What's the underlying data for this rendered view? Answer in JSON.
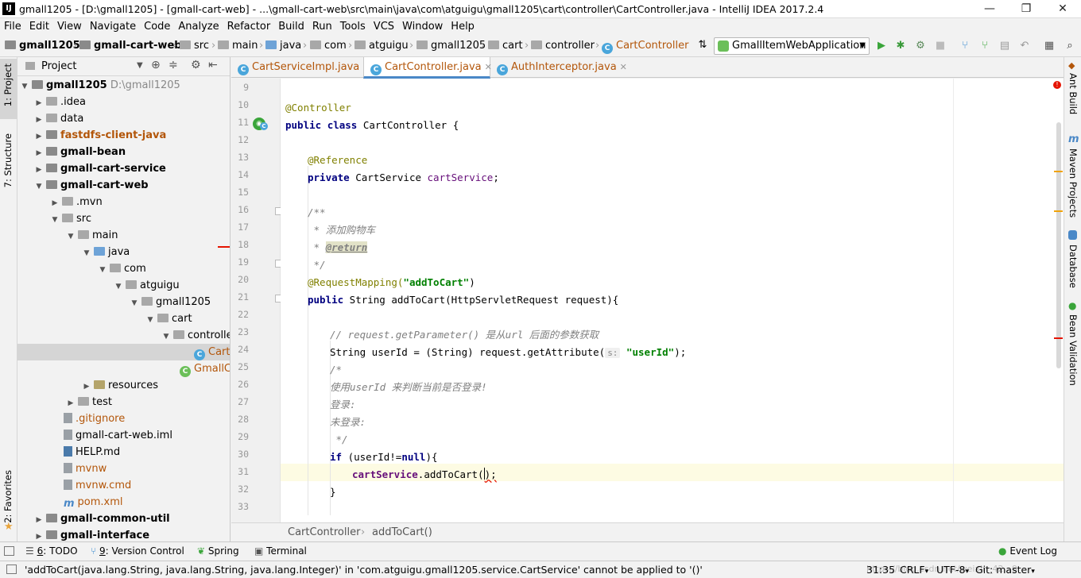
{
  "window": {
    "title": "gmall1205 - [D:\\gmall1205] - [gmall-cart-web] - ...\\gmall-cart-web\\src\\main\\java\\com\\atguigu\\gmall1205\\cart\\controller\\CartController.java - IntelliJ IDEA 2017.2.4",
    "minimize": "—",
    "maximize": "❐",
    "close": "✕"
  },
  "menu": [
    "File",
    "Edit",
    "View",
    "Navigate",
    "Code",
    "Analyze",
    "Refactor",
    "Build",
    "Run",
    "Tools",
    "VCS",
    "Window",
    "Help"
  ],
  "navbar": {
    "crumbs": [
      "gmall1205",
      "gmall-cart-web",
      "src",
      "main",
      "java",
      "com",
      "atguigu",
      "gmall1205",
      "cart",
      "controller",
      "CartController"
    ],
    "run_config": "GmallItemWebApplication"
  },
  "left_stripe": {
    "project": "1: Project",
    "structure": "7: Structure",
    "favorites": "2: Favorites"
  },
  "right_stripe": {
    "ant": "Ant Build",
    "maven": "Maven Projects",
    "database": "Database",
    "bean": "Bean Validation"
  },
  "project_panel": {
    "title": "Project",
    "tree": [
      {
        "label": "gmall1205",
        "extra": "D:\\gmall1205",
        "arrow": "▼"
      },
      {
        "label": ".idea",
        "arrow": "▶"
      },
      {
        "label": "data",
        "arrow": "▶"
      },
      {
        "label": "fastdfs-client-java",
        "arrow": "▶"
      },
      {
        "label": "gmall-bean",
        "arrow": "▶"
      },
      {
        "label": "gmall-cart-service",
        "arrow": "▶"
      },
      {
        "label": "gmall-cart-web",
        "arrow": "▼"
      },
      {
        "label": ".mvn",
        "arrow": "▶"
      },
      {
        "label": "src",
        "arrow": "▼"
      },
      {
        "label": "main",
        "arrow": "▼"
      },
      {
        "label": "java",
        "arrow": "▼"
      },
      {
        "label": "com",
        "arrow": "▼"
      },
      {
        "label": "atguigu",
        "arrow": "▼"
      },
      {
        "label": "gmall1205",
        "arrow": "▼"
      },
      {
        "label": "cart",
        "arrow": "▼"
      },
      {
        "label": "controller",
        "arrow": "▼"
      },
      {
        "label": "Cart"
      },
      {
        "label": "GmallCa"
      },
      {
        "label": "resources",
        "arrow": "▶"
      },
      {
        "label": "test",
        "arrow": "▶"
      },
      {
        "label": ".gitignore"
      },
      {
        "label": "gmall-cart-web.iml"
      },
      {
        "label": "HELP.md"
      },
      {
        "label": "mvnw"
      },
      {
        "label": "mvnw.cmd"
      },
      {
        "label": "pom.xml"
      },
      {
        "label": "gmall-common-util",
        "arrow": "▶"
      },
      {
        "label": "gmall-interface",
        "arrow": "▶"
      }
    ]
  },
  "tabs": [
    "CartServiceImpl.java",
    "CartController.java",
    "AuthInterceptor.java"
  ],
  "editor": {
    "line_numbers": [
      "9",
      "10",
      "11",
      "12",
      "13",
      "14",
      "15",
      "16",
      "17",
      "18",
      "19",
      "20",
      "21",
      "22",
      "23",
      "24",
      "25",
      "26",
      "27",
      "28",
      "29",
      "30",
      "31",
      "32",
      "33"
    ],
    "l10_ann": "@Controller",
    "l11_kw1": "public",
    "l11_kw2": "class",
    "l11_rest": " CartController {",
    "l13_ann": "@Reference",
    "l14_kw": "private",
    "l14_type": " CartService ",
    "l14_field": "cartService",
    "l14_end": ";",
    "l16": "/**",
    "l17": " * 添加购物车",
    "l18_star": " * ",
    "l18_tag": "@return",
    "l19": " */",
    "l20_ann": "@RequestMapping(",
    "l20_str": "\"addToCart\"",
    "l20_end": ")",
    "l21_kw": "public",
    "l21_rest": " String addToCart(HttpServletRequest request){",
    "l23": "// request.getParameter() 是从url 后面的参数获取",
    "l24_pre": "String userId = (String) request.getAttribute(",
    "l24_hint": "s:",
    "l24_str": "\"userId\"",
    "l24_end": ");",
    "l25": "/*",
    "l26": "使用userId 来判断当前是否登录!",
    "l27": "登录:",
    "l28": "未登录:",
    "l29": " */",
    "l30_kw": "if",
    "l30_mid": " (userId!=",
    "l30_kw2": "null",
    "l30_end": "){",
    "l31_field": "cartService",
    "l31_rest": ".addToCart(",
    "l31_end": ");",
    "l32": "}"
  },
  "editor_breadcrumb": [
    "CartController",
    "addToCart()"
  ],
  "bottom_tools": [
    {
      "num": "6",
      "label": ": TODO"
    },
    {
      "num": "9",
      "label": ": Version Control"
    },
    {
      "num": "",
      "label": "Spring"
    },
    {
      "num": "",
      "label": "Terminal"
    }
  ],
  "event_log": "Event Log",
  "status": {
    "message": "'addToCart(java.lang.String, java.lang.String, java.lang.Integer)' in 'com.atguigu.gmall1205.service.CartService' cannot be applied to '()'",
    "position": "31:35",
    "line_sep": "CRLF",
    "encoding": "UTF-8",
    "vcs": "Git: master",
    "watermark": "https://blog.csdn.net/weixin_42...9"
  },
  "colors": {
    "accent": "#4a88c7",
    "error": "#e51400",
    "warning": "#f0a30a"
  }
}
